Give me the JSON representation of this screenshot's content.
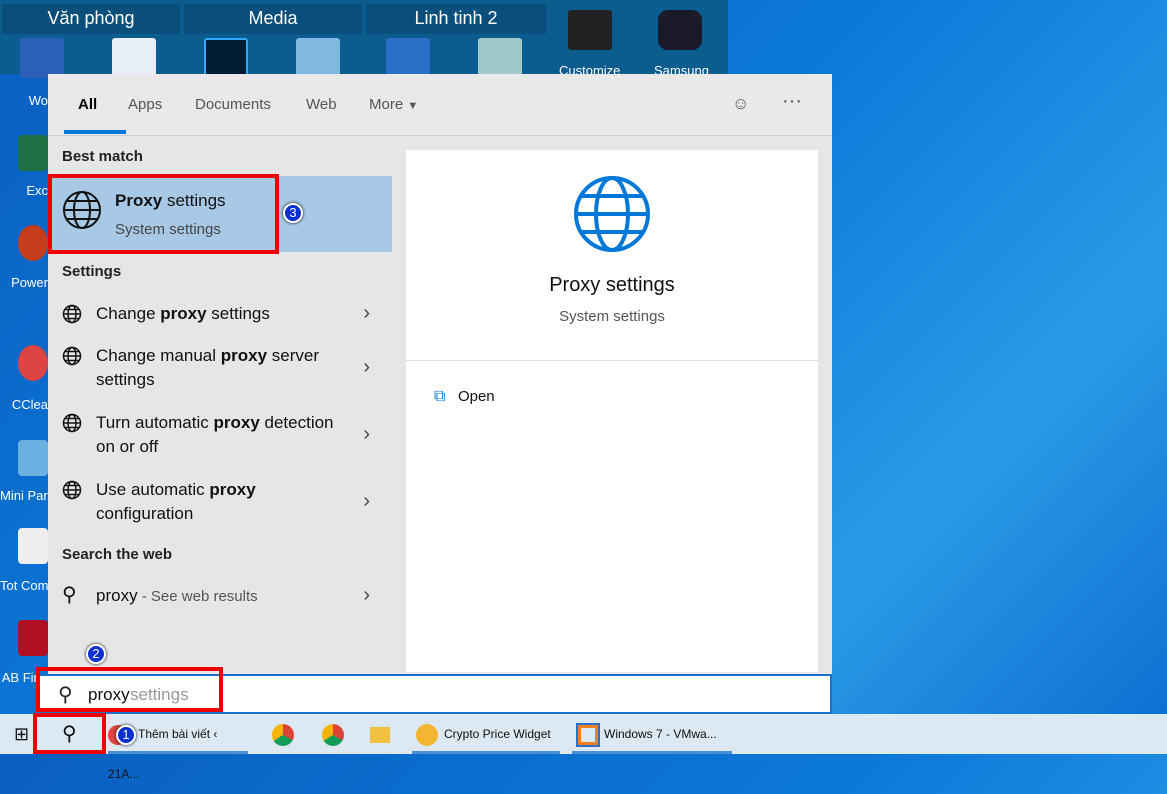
{
  "tile_groups": [
    "Văn phòng",
    "Media",
    "Linh tinh 2"
  ],
  "tile_labels": [
    "Customize",
    "Samsung"
  ],
  "desktop_labels": [
    "Wo",
    "Exc",
    "Power",
    "CClea",
    "Mini Part",
    "Tot Comm",
    "AB Fine"
  ],
  "tabs": [
    {
      "label": "All",
      "active": true
    },
    {
      "label": "Apps"
    },
    {
      "label": "Documents"
    },
    {
      "label": "Web"
    },
    {
      "label": "More"
    }
  ],
  "best_match": {
    "header": "Best match",
    "title_bold": "Proxy",
    "title_rest": " settings",
    "subtitle": "System settings"
  },
  "settings": {
    "header": "Settings",
    "items": [
      {
        "pre": "Change ",
        "bold": "proxy",
        "post": " settings"
      },
      {
        "pre": "Change manual ",
        "bold": "proxy",
        "post": " server settings"
      },
      {
        "pre": "Turn automatic ",
        "bold": "proxy",
        "post": " detection on or off"
      },
      {
        "pre": "Use automatic ",
        "bold": "proxy",
        "post": " configuration"
      }
    ]
  },
  "web": {
    "header": "Search the web",
    "query": "proxy",
    "suffix": " - See web results"
  },
  "preview": {
    "title": "Proxy settings",
    "subtitle": "System settings",
    "open_label": "Open"
  },
  "search": {
    "typed": "proxy",
    "suggestion": " settings"
  },
  "taskbar": {
    "items": [
      "Thêm bài viết ‹ 21A...",
      "Crypto Price Widget",
      "Windows 7 - VMwa..."
    ]
  },
  "steps": [
    "1",
    "2",
    "3"
  ],
  "colors": {
    "accent": "#0078d7",
    "highlight": "#a8c9e6",
    "annotation": "#e00000"
  }
}
